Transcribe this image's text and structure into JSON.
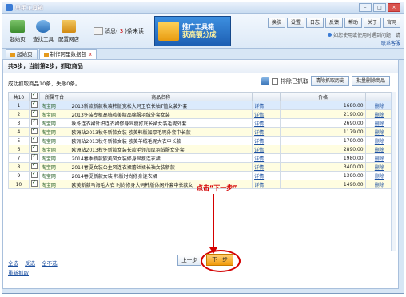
{
  "window": {
    "title": "甩手工具箱"
  },
  "toolbar": {
    "tools": [
      {
        "label": "起始页",
        "icon": "home-icon"
      },
      {
        "label": "查找工具",
        "icon": "search-icon"
      },
      {
        "label": "配置网店",
        "icon": "settings-icon"
      }
    ],
    "message_label": "消息(",
    "message_count": "3",
    "message_suffix": ")条未读"
  },
  "banner": {
    "line1": "推广工具箱",
    "line2": "获高额分成"
  },
  "top_buttons": [
    "换肤",
    "设置",
    "日志",
    "反馈",
    "帮助",
    "关于",
    "官网"
  ],
  "hint": {
    "line1": "如您使用或使用时遇到问题：请",
    "line2": "联系客服"
  },
  "tabs": [
    {
      "label": "起始页"
    },
    {
      "label": "制作阿里数据包"
    }
  ],
  "step": {
    "text": "共3步，当前第2步，抓取商品"
  },
  "status": {
    "text": "成功抓取商品10条，失败0条。"
  },
  "controls": {
    "exclude_label": "排除已抓取",
    "clear_history": "清除抓取历史",
    "batch_edit": "批量删除商品"
  },
  "table": {
    "headers": [
      "共10",
      "",
      "所属平台",
      "商品名称",
      "",
      "价格",
      ""
    ],
    "rows": [
      {
        "num": "1",
        "shop": "淘宝网",
        "name": "2013新款新款秋装韩版宽松大码卫衣长袖T恤女装外套",
        "edit": "详情",
        "price": "1680.00",
        "del": "删除"
      },
      {
        "num": "2",
        "shop": "淘宝网",
        "name": "2013冬装专柜高档欧美精品棉服羽绒外套女装",
        "edit": "详情",
        "price": "2190.00",
        "del": "删除"
      },
      {
        "num": "3",
        "shop": "淘宝网",
        "name": "秋冬连衣裙针织连衣裙修身显瘦打底长裙女装毛呢外套",
        "edit": "详情",
        "price": "2690.00",
        "del": "删除"
      },
      {
        "num": "4",
        "shop": "淘宝网",
        "name": "欧洲站2013秋冬新款女装 欧美韩版加厚毛呢外套中长款",
        "edit": "详情",
        "price": "1179.00",
        "del": "删除"
      },
      {
        "num": "5",
        "shop": "淘宝网",
        "name": "欧洲站2013秋冬新款女装 欧美羊绒毛呢大衣中长款",
        "edit": "详情",
        "price": "1790.00",
        "del": "删除"
      },
      {
        "num": "6",
        "shop": "淘宝网",
        "name": "欧洲站2013秋冬新款女装长款毛领加厚羽绒服女外套",
        "edit": "详情",
        "price": "2890.00",
        "del": "删除"
      },
      {
        "num": "7",
        "shop": "淘宝网",
        "name": "2014春季新款欧美风女装修身显瘦连衣裙",
        "edit": "详情",
        "price": "1980.00",
        "del": "删除"
      },
      {
        "num": "8",
        "shop": "淘宝网",
        "name": "2014春夏女装公主风连衣裙蕾丝裙长袖女装新款",
        "edit": "详情",
        "price": "3400.00",
        "del": "删除"
      },
      {
        "num": "9",
        "shop": "淘宝网",
        "name": "2014春夏新款女装 韩版时尚修身连衣裙",
        "edit": "详情",
        "price": "1390.00",
        "del": "删除"
      },
      {
        "num": "10",
        "shop": "淘宝网",
        "name": "欧美新款马海毛大衣 时尚修身大码韩版休闲外套中长款女",
        "edit": "详情",
        "price": "1490.00",
        "del": "删除"
      }
    ]
  },
  "annotation": {
    "text": "点击“下一步”"
  },
  "bottom": {
    "select_all": "全选",
    "invert": "反选",
    "none": "全不选",
    "refresh": "重新抓取",
    "prev": "上一步",
    "next": "下一步"
  }
}
